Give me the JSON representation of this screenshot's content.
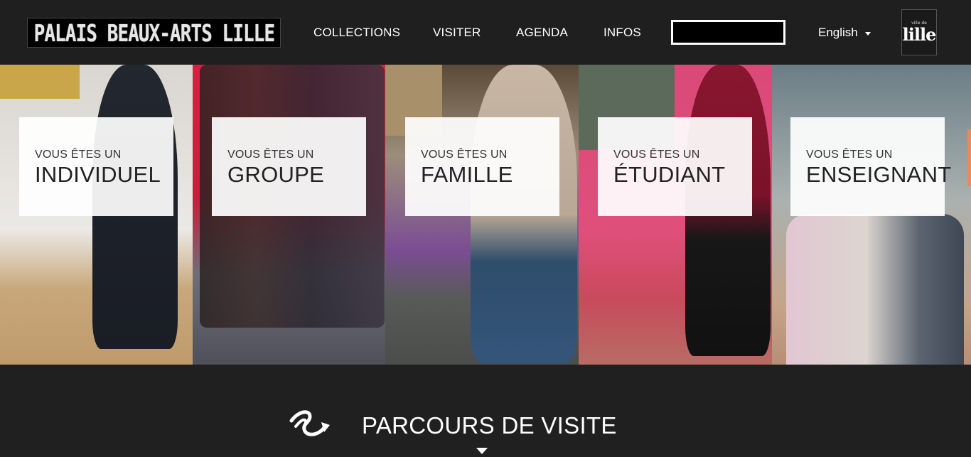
{
  "header": {
    "logo_text": "PALAIS BEAUX-ARTS LILLE",
    "nav": [
      {
        "label": "COLLECTIONS"
      },
      {
        "label": "VISITER"
      },
      {
        "label": "AGENDA"
      },
      {
        "label": "INFOS"
      }
    ],
    "search": {
      "value": "",
      "placeholder": ""
    },
    "language": {
      "label": "English"
    },
    "partner_logo": {
      "small_text": "ville de",
      "big_text": "lille"
    }
  },
  "hero": {
    "cards": [
      {
        "pre": "VOUS ÊTES UN",
        "main": "INDIVIDUEL"
      },
      {
        "pre": "VOUS ÊTES UN",
        "main": "GROUPE"
      },
      {
        "pre": "VOUS ÊTES UN",
        "main": "FAMILLE"
      },
      {
        "pre": "VOUS ÊTES UN",
        "main": "ÉTUDIANT"
      },
      {
        "pre": "VOUS ÊTES UN",
        "main": "ENSEIGNANT"
      }
    ]
  },
  "section": {
    "title": "PARCOURS DE VISITE",
    "icon": "route-arrow-icon"
  },
  "colors": {
    "header_bg": "#1f1f1f",
    "section_bg": "#202020",
    "card_bg": "#ffffff",
    "accent": "#e88a5a"
  }
}
